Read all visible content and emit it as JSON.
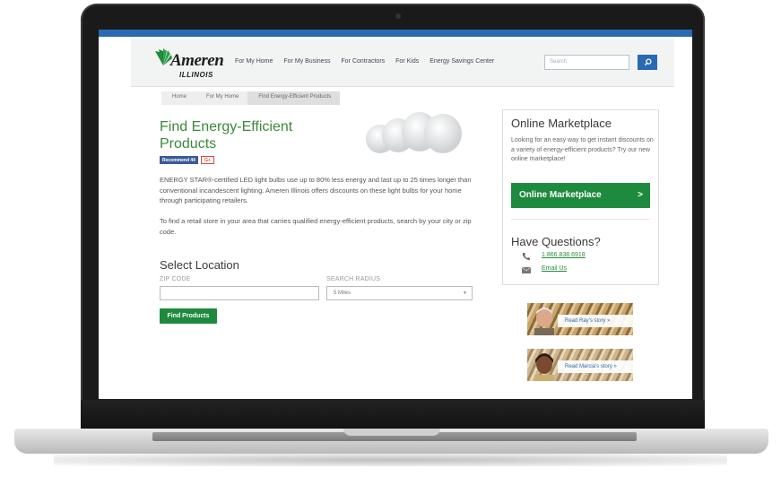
{
  "brand": {
    "name": "Ameren",
    "sub": "ILLINOIS"
  },
  "nav": {
    "items": [
      {
        "label": "For My Home"
      },
      {
        "label": "For My Business"
      },
      {
        "label": "For Contractors"
      },
      {
        "label": "For Kids"
      },
      {
        "label": "Energy Savings Center"
      }
    ]
  },
  "search": {
    "placeholder": "Search"
  },
  "breadcrumb": {
    "items": [
      {
        "label": "Home"
      },
      {
        "label": "For My Home"
      },
      {
        "label": "Find Energy-Efficient Products"
      }
    ]
  },
  "main": {
    "title": "Find Energy-Efficient Products",
    "social": {
      "recommend_label": "Recommend 44",
      "gplus_label": "G+"
    },
    "para1": "ENERGY STAR®-certified LED light bulbs use up to 80% less energy and last up to 25 times longer than conventional incandescent lighting. Ameren Illinois offers discounts on these light bulbs for your home through participating retailers.",
    "para2": "To find a retail store in your area that carries qualified energy-efficient products, search by your city or zip code.",
    "location_heading": "Select Location",
    "zip_label": "ZIP CODE",
    "radius_label": "SEARCH RADIUS",
    "radius_value": "5 Miles",
    "find_button": "Find Products"
  },
  "sidebar": {
    "marketplace_title": "Online Marketplace",
    "marketplace_text": "Looking for an easy way to get instant discounts on a variety of energy-efficient products?  Try our new online marketplace!",
    "marketplace_button": "Online Marketplace",
    "marketplace_arrow": ">",
    "questions_title": "Have Questions?",
    "phone": "1.866.838.6918",
    "email_label": "Email Us"
  },
  "stories": [
    {
      "label": "Read Ray's story »"
    },
    {
      "label": "Read Marcia's story »"
    }
  ],
  "colors": {
    "accent_blue": "#2a69b3",
    "accent_green": "#1e8a3e",
    "title_green": "#3a8a3a"
  }
}
